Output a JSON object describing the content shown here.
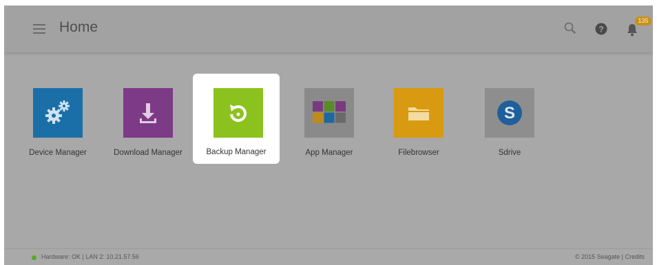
{
  "header": {
    "title": "Home",
    "notification_count": "135",
    "icons": [
      "menu-icon",
      "search-icon",
      "help-icon",
      "bell-icon"
    ]
  },
  "apps": [
    {
      "label": "Device Manager",
      "icon": "gears-icon",
      "color": "#1a6fa8"
    },
    {
      "label": "Download Manager",
      "icon": "download-icon",
      "color": "#7d3a86"
    },
    {
      "label": "Backup Manager",
      "icon": "backup-icon",
      "color": "#8cc21e",
      "selected": true
    },
    {
      "label": "App Manager",
      "icon": "app-grid-icon",
      "color": "#8a8a8a"
    },
    {
      "label": "Filebrowser",
      "icon": "folder-icon",
      "color": "#d89a10"
    },
    {
      "label": "Sdrive",
      "icon": "sdrive-icon",
      "color": "#1f5f9c"
    }
  ],
  "footer": {
    "status": "Hardware: OK | LAN 2: 10.21.57.56",
    "credits": "© 2015 Seagate | Credits"
  },
  "colors": {
    "status_ok": "#5aa829",
    "badge": "#c8901a"
  }
}
